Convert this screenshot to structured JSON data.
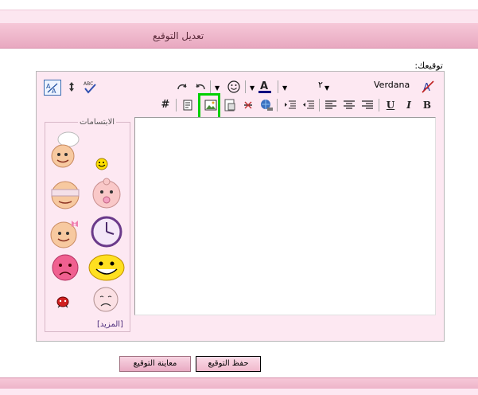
{
  "header": {
    "title": "تعديل التوقيع"
  },
  "form": {
    "signature_label": "توقيعك:"
  },
  "toolbar": {
    "font_name": "Verdana",
    "font_size": "٢",
    "row2_hash": "#",
    "underline": "U",
    "italic": "I",
    "bold": "B",
    "spell_label": "ABC"
  },
  "smilies": {
    "title": "الابتسامات",
    "more": "[المزيد]"
  },
  "buttons": {
    "preview": "معاينة التوقيع",
    "save": "حفظ التوقيع"
  }
}
